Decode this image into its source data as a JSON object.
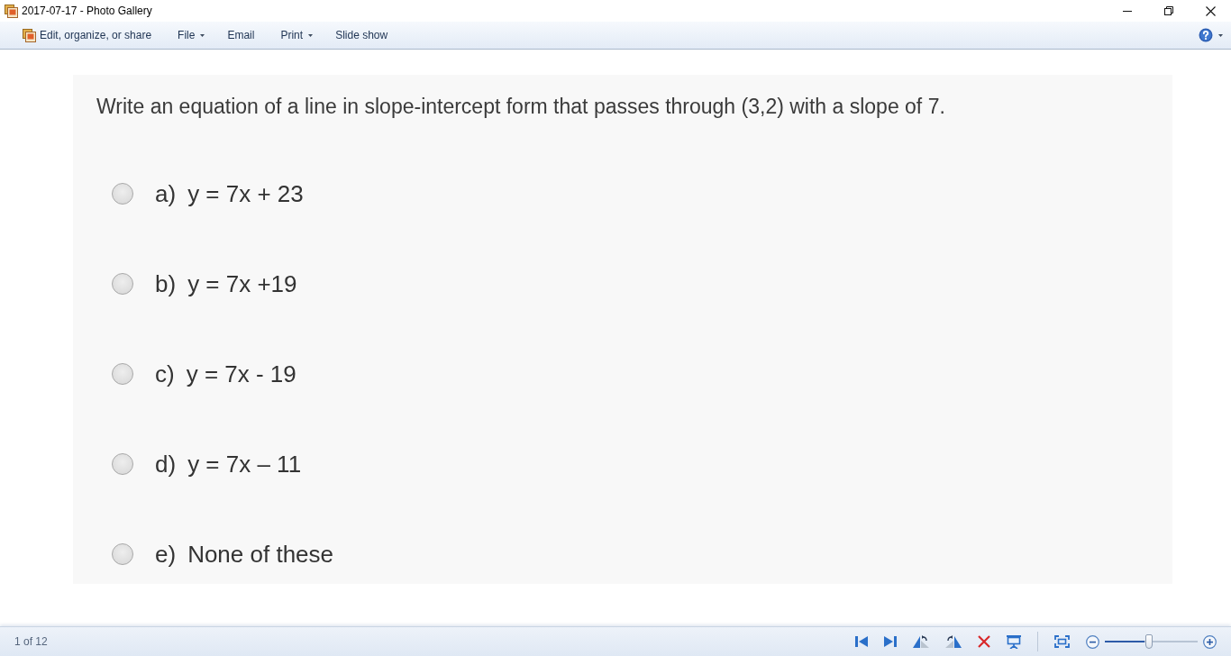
{
  "window": {
    "title": "2017-07-17 - Photo Gallery"
  },
  "toolbar": {
    "items": [
      {
        "label": "Edit, organize, or share",
        "kind": "with_icon"
      },
      {
        "label": "File",
        "kind": "dropdown"
      },
      {
        "label": "Email",
        "kind": "plain"
      },
      {
        "label": "Print",
        "kind": "dropdown"
      },
      {
        "label": "Slide show",
        "kind": "plain"
      }
    ]
  },
  "photo": {
    "question": "Write an equation of a line in slope-intercept form that passes through (3,2) with a slope of 7.",
    "options": [
      {
        "letter": "a)",
        "text": "y = 7x + 23",
        "selected": false
      },
      {
        "letter": "b)",
        "text": "y = 7x +19",
        "selected": false
      },
      {
        "letter": "c)",
        "text": "y = 7x - 19",
        "selected": false
      },
      {
        "letter": "d)",
        "text": "y = 7x – 11",
        "selected": false
      },
      {
        "letter": "e)",
        "text": "None of these",
        "selected": false
      }
    ]
  },
  "status_bar": {
    "position": "1 of 12",
    "zoom": {
      "level": 0.48
    }
  }
}
